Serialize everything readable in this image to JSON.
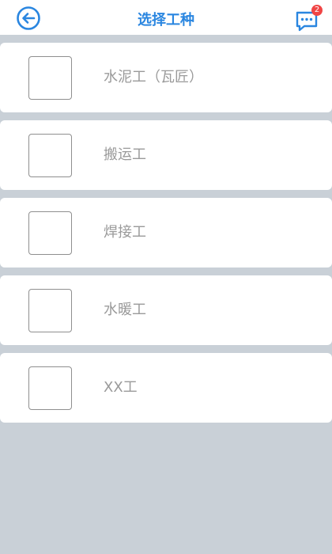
{
  "header": {
    "title": "选择工种",
    "back_icon": "arrow-left-circle-icon",
    "message_icon": "chat-bubble-icon",
    "message_badge": "2",
    "accent_color": "#2a86e0",
    "badge_color": "#f04545"
  },
  "options": [
    {
      "label": "水泥工（瓦匠）",
      "checked": false
    },
    {
      "label": "搬运工",
      "checked": false
    },
    {
      "label": "焊接工",
      "checked": false
    },
    {
      "label": "水暖工",
      "checked": false
    },
    {
      "label": "XX工",
      "checked": false
    }
  ]
}
